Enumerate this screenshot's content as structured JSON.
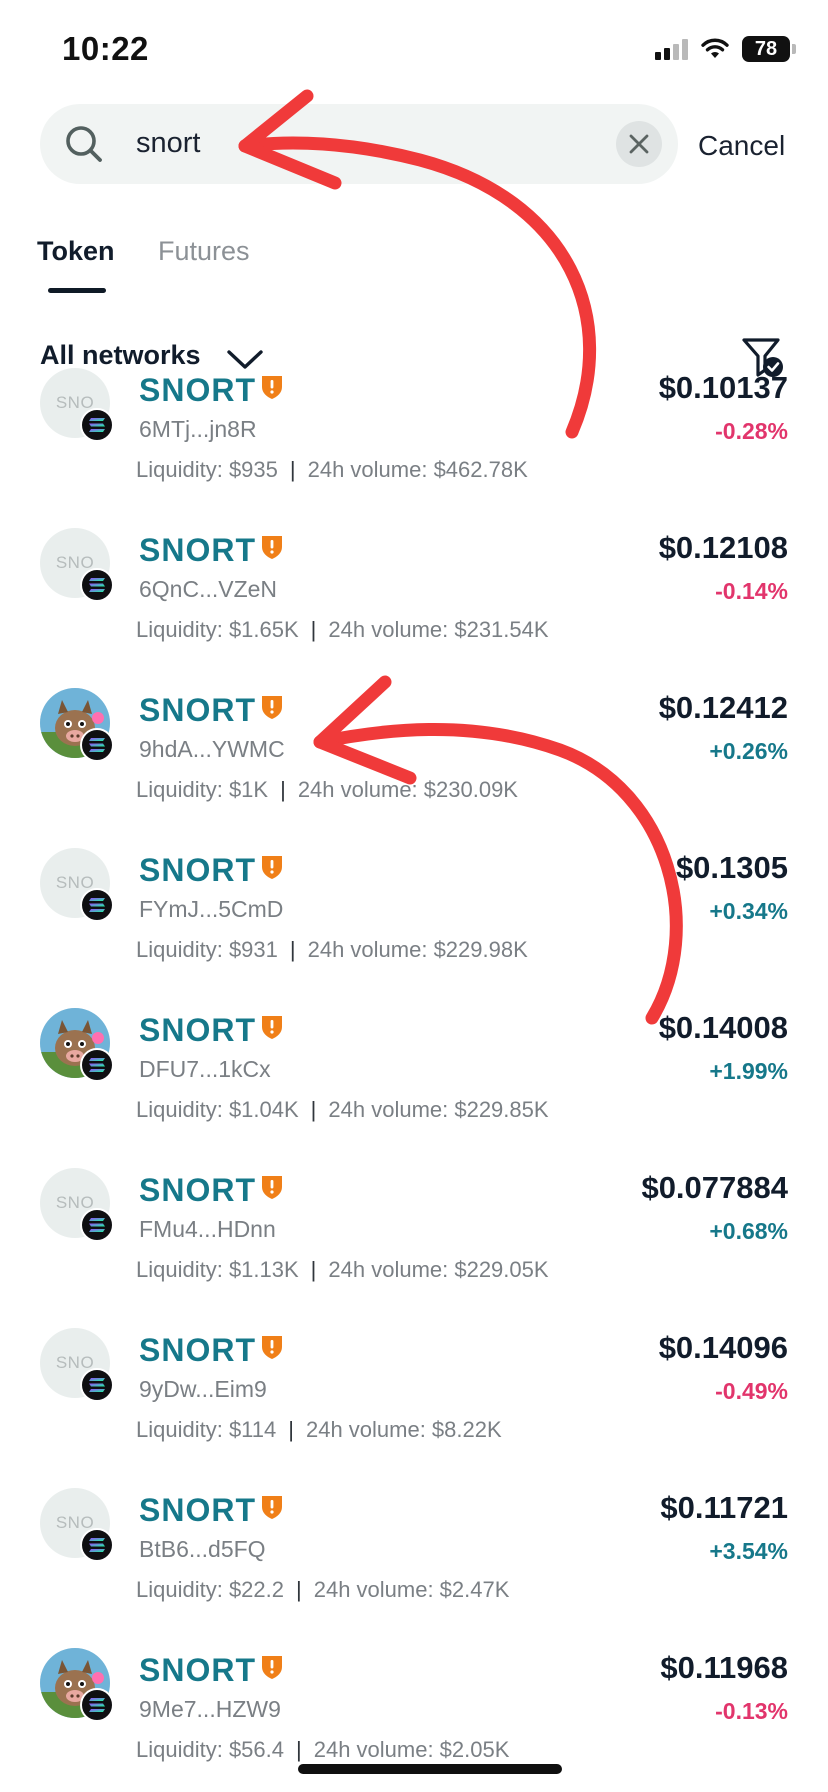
{
  "status_bar": {
    "time": "10:22",
    "battery": "78"
  },
  "search": {
    "value": "snort",
    "cancel_label": "Cancel"
  },
  "tabs": [
    {
      "label": "Token"
    },
    {
      "label": "Futures"
    }
  ],
  "network_filter": {
    "label": "All networks"
  },
  "colors": {
    "accent": "#16788a",
    "negative": "#e2356c",
    "annotation": "#f03a3a"
  },
  "tokens": [
    {
      "name": "SNORT",
      "address": "6MTj...jn8R",
      "liquidity": "Liquidity: $935",
      "volume": "24h volume: $462.78K",
      "price": "$0.10137",
      "change": "-0.28%",
      "avatar": "SNO"
    },
    {
      "name": "SNORT",
      "address": "6QnC...VZeN",
      "liquidity": "Liquidity: $1.65K",
      "volume": "24h volume: $231.54K",
      "price": "$0.12108",
      "change": "-0.14%",
      "avatar": "SNO"
    },
    {
      "name": "SNORT",
      "address": "9hdA...YWMC",
      "liquidity": "Liquidity: $1K",
      "volume": "24h volume: $230.09K",
      "price": "$0.12412",
      "change": "+0.26%",
      "avatar": "image"
    },
    {
      "name": "SNORT",
      "address": "FYmJ...5CmD",
      "liquidity": "Liquidity: $931",
      "volume": "24h volume: $229.98K",
      "price": "$0.1305",
      "change": "+0.34%",
      "avatar": "SNO"
    },
    {
      "name": "SNORT",
      "address": "DFU7...1kCx",
      "liquidity": "Liquidity: $1.04K",
      "volume": "24h volume: $229.85K",
      "price": "$0.14008",
      "change": "+1.99%",
      "avatar": "image"
    },
    {
      "name": "SNORT",
      "address": "FMu4...HDnn",
      "liquidity": "Liquidity: $1.13K",
      "volume": "24h volume: $229.05K",
      "price": "$0.077884",
      "change": "+0.68%",
      "avatar": "SNO"
    },
    {
      "name": "SNORT",
      "address": "9yDw...Eim9",
      "liquidity": "Liquidity: $114",
      "volume": "24h volume: $8.22K",
      "price": "$0.14096",
      "change": "-0.49%",
      "avatar": "SNO"
    },
    {
      "name": "SNORT",
      "address": "BtB6...d5FQ",
      "liquidity": "Liquidity: $22.2",
      "volume": "24h volume: $2.47K",
      "price": "$0.11721",
      "change": "+3.54%",
      "avatar": "SNO"
    },
    {
      "name": "SNORT",
      "address": "9Me7...HZW9",
      "liquidity": "Liquidity: $56.4",
      "volume": "24h volume: $2.05K",
      "price": "$0.11968",
      "change": "-0.13%",
      "avatar": "image"
    }
  ]
}
